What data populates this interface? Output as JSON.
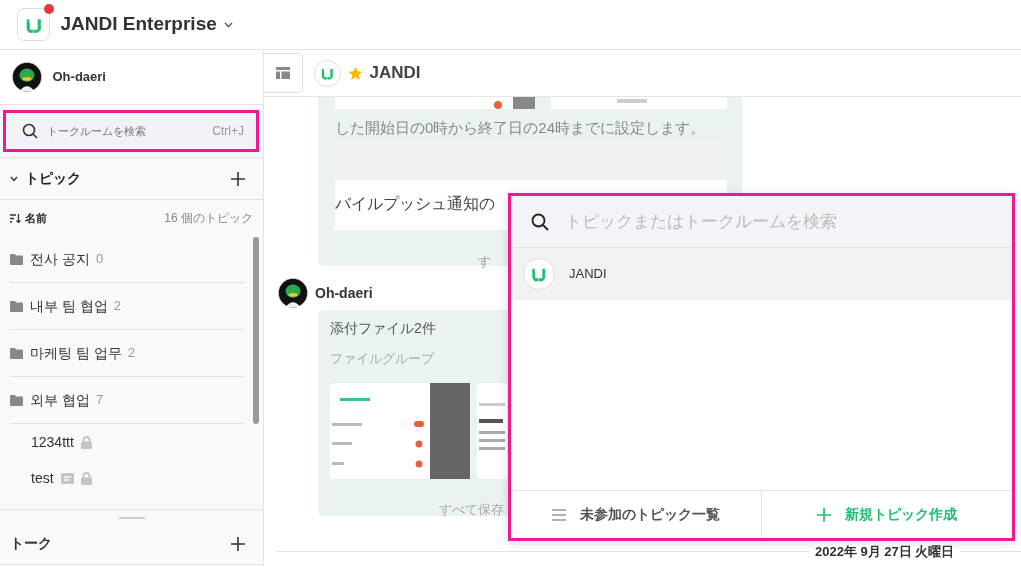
{
  "workspace": {
    "name": "JANDI Enterprise",
    "notification": true
  },
  "profile": {
    "name": "Oh-daeri"
  },
  "sidebar_search": {
    "placeholder": "トークルームを検索",
    "shortcut": "Ctrl+J"
  },
  "topics_section": {
    "title": "トピック",
    "expanded": true
  },
  "sort": {
    "label": "名前",
    "count": "16 個のトピック"
  },
  "topics": [
    {
      "kind": "folder",
      "name": "전사 공지",
      "count": "0"
    },
    {
      "kind": "folder",
      "name": "내부 팀 협업",
      "count": "2"
    },
    {
      "kind": "folder",
      "name": "마케팅 팀 업무",
      "count": "2"
    },
    {
      "kind": "folder",
      "name": "외부 협업",
      "count": "7"
    },
    {
      "kind": "topic",
      "name": "1234ttt",
      "board": false,
      "locked": true
    },
    {
      "kind": "topic",
      "name": "test",
      "board": true,
      "locked": true
    }
  ],
  "talk_section": {
    "title": "トーク"
  },
  "room": {
    "name": "JANDI",
    "starred": true
  },
  "messages": [
    {
      "kind": "preview",
      "lines": [
        "した開始日の0時から終了日の24時までに設定します。",
        "バイルプッシュ通知の"
      ],
      "footer": "す"
    },
    {
      "kind": "files",
      "author": "Oh-daeri",
      "title": "添付ファイル2件",
      "group": "ファイルグループ",
      "footer": "すべて保存"
    }
  ],
  "date_divider": "2022年 9月 27日 火曜日",
  "popup": {
    "placeholder": "トピックまたはトークルームを検索",
    "results": [
      {
        "name": "JANDI",
        "selected": true
      }
    ],
    "footer_buttons": [
      {
        "kind": "list",
        "label": "未参加のトピック一覧"
      },
      {
        "kind": "create",
        "label": "新規トピック作成"
      }
    ]
  }
}
